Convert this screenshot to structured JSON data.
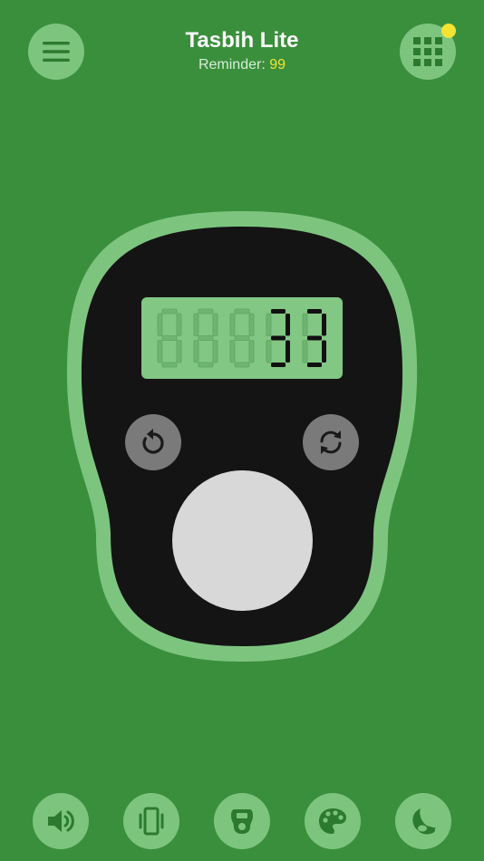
{
  "header": {
    "title": "Tasbih Lite",
    "reminder_label": "Reminder: ",
    "reminder_value": "99"
  },
  "counter": {
    "display_value": "00033",
    "digit_count": 5
  },
  "colors": {
    "background": "#3a8f3c",
    "accent_light": "#7dc57f",
    "icon_dark": "#2c7a2f",
    "notification": "#f3e333",
    "device_body": "#141414",
    "tap_button": "#d8d8d8",
    "small_button": "#7a7a7a"
  },
  "icons": {
    "menu": "hamburger-menu-icon",
    "grid": "grid-apps-icon",
    "reset": "reset-icon",
    "cycle": "cycle-icon",
    "sound": "volume-icon",
    "vibrate": "vibration-icon",
    "counter": "counter-device-icon",
    "theme": "palette-icon",
    "night": "night-mode-icon"
  }
}
